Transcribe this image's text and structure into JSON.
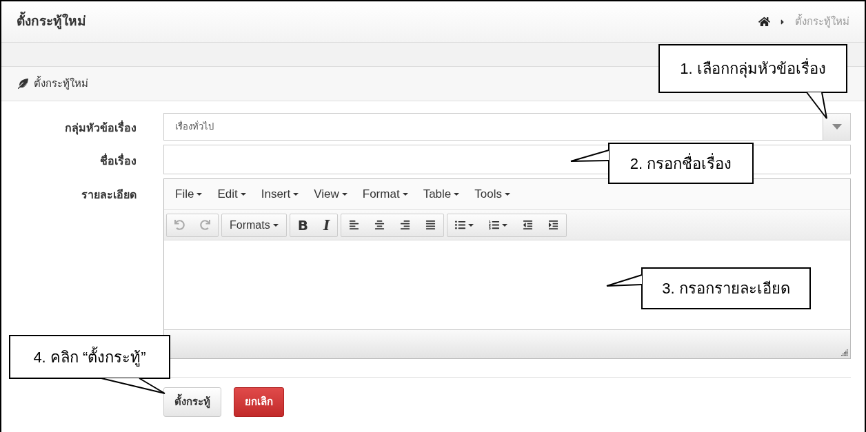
{
  "header": {
    "title": "ตั้งกระทู้ใหม่",
    "breadcrumb": {
      "current": "ตั้งกระทู้ใหม่"
    }
  },
  "panel": {
    "title": "ตั้งกระทู้ใหม่"
  },
  "form": {
    "category": {
      "label": "กลุ่มหัวข้อเรื่อง",
      "value": "เรื่องทั่วไป"
    },
    "subject": {
      "label": "ชื่อเรื่อง"
    },
    "details": {
      "label": "รายละเอียด",
      "menu": [
        "File",
        "Edit",
        "Insert",
        "View",
        "Format",
        "Table",
        "Tools"
      ],
      "toolbar": [
        [
          {
            "kind": "undo",
            "disabled": true,
            "dropdown": false
          },
          {
            "kind": "redo",
            "disabled": true,
            "dropdown": false
          }
        ],
        [
          {
            "kind": "text",
            "label": "Formats",
            "disabled": false,
            "dropdown": true
          }
        ],
        [
          {
            "kind": "bold",
            "label": "B",
            "disabled": false,
            "dropdown": false
          },
          {
            "kind": "italic",
            "label": "I",
            "disabled": false,
            "dropdown": false
          }
        ],
        [
          {
            "kind": "align-left",
            "disabled": false,
            "dropdown": false
          },
          {
            "kind": "align-center",
            "disabled": false,
            "dropdown": false
          },
          {
            "kind": "align-right",
            "disabled": false,
            "dropdown": false
          },
          {
            "kind": "align-justify",
            "disabled": false,
            "dropdown": false
          }
        ],
        [
          {
            "kind": "bullet-list",
            "disabled": false,
            "dropdown": true
          },
          {
            "kind": "numbered-list",
            "disabled": false,
            "dropdown": true
          },
          {
            "kind": "outdent",
            "disabled": false,
            "dropdown": false
          },
          {
            "kind": "indent",
            "disabled": false,
            "dropdown": false
          }
        ]
      ]
    }
  },
  "buttons": [
    {
      "label": "ตั้งกระทู้",
      "kind": "default"
    },
    {
      "label": "ยกเลิก",
      "kind": "danger"
    }
  ],
  "callouts": [
    {
      "text": "1. เลือกกลุ่มหัวข้อเรื่อง"
    },
    {
      "text": "2. กรอกชื่อเรื่อง"
    },
    {
      "text": "3. กรอกรายละเอียด"
    },
    {
      "text": "4. คลิก “ตั้งกระทู้”"
    }
  ]
}
